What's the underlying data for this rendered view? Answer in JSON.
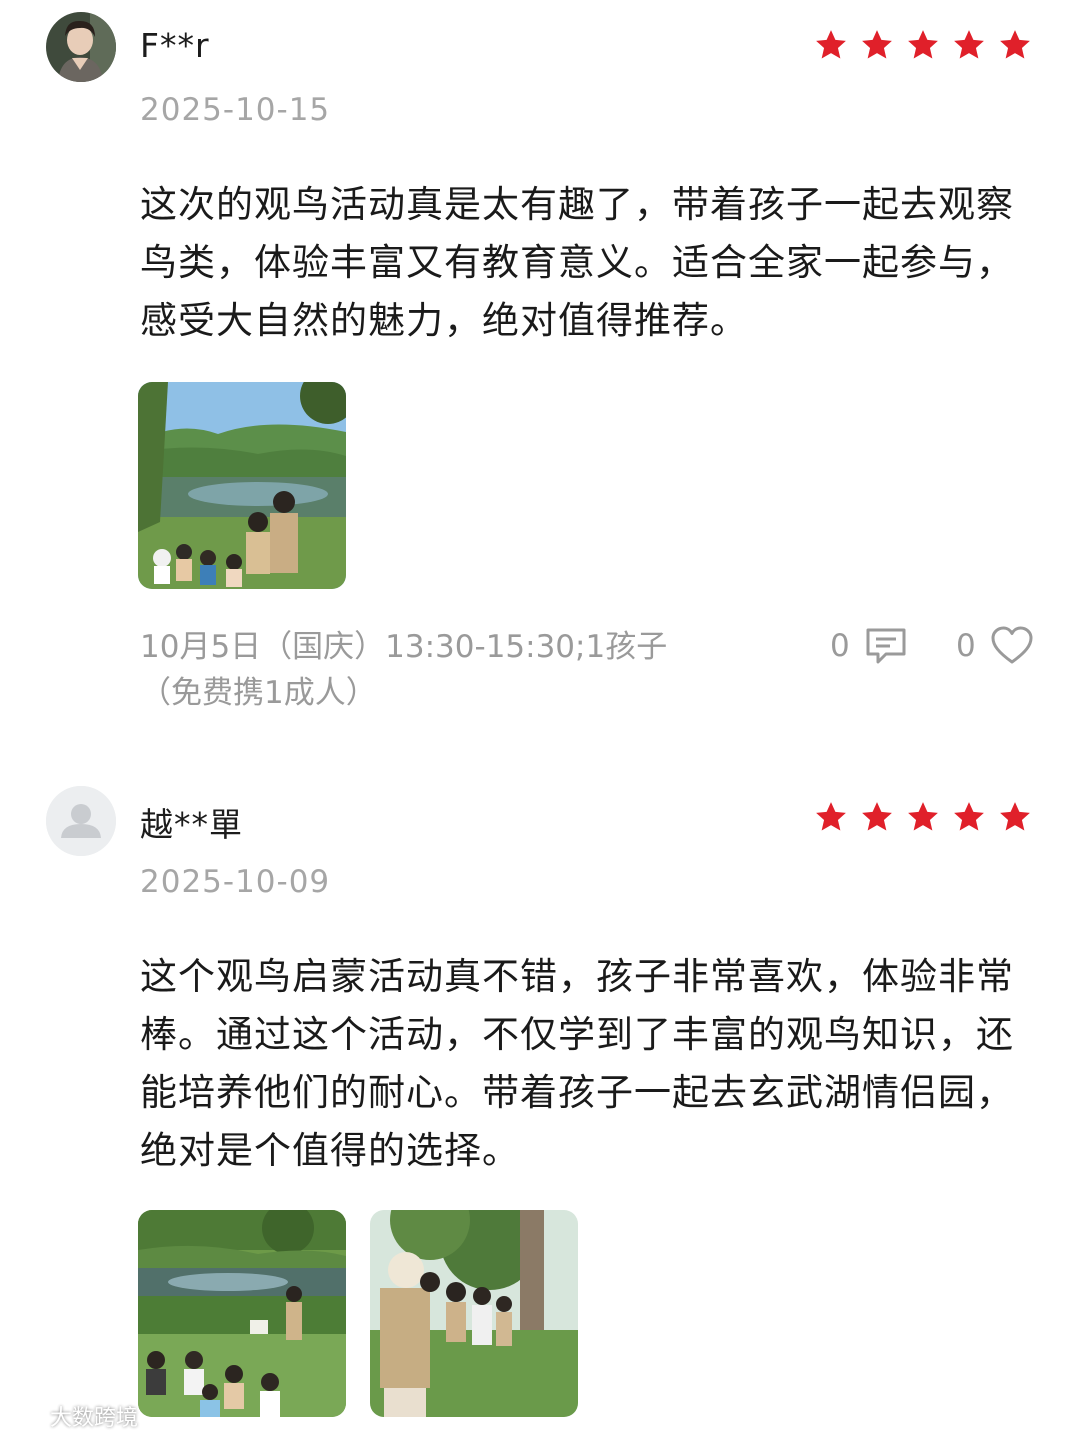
{
  "reviews": [
    {
      "username": "F**r",
      "date": "2025-10-15",
      "rating": 5,
      "content": "这次的观鸟活动真是太有趣了，带着孩子一起去观察鸟类，体验丰富又有教育意义。适合全家一起参与，感受大自然的魅力，绝对值得推荐。",
      "photos": [
        "park-pond-children-photo"
      ],
      "session": "10月5日（国庆）13:30-15:30;1孩子（免费携1成人）",
      "comment_count": "0",
      "like_count": "0"
    },
    {
      "username": "越**單",
      "date": "2025-10-09",
      "rating": 5,
      "content": "这个观鸟启蒙活动真不错，孩子非常喜欢，体验非常棒。通过这个活动，不仅学到了丰富的观鸟知识，还能培养他们的耐心。带着孩子一起去玄武湖情侣园，绝对是个值得的选择。",
      "photos": [
        "lakeside-lesson-photo",
        "children-binoculars-photo"
      ]
    }
  ],
  "watermark": "大数跨境",
  "colors": {
    "star": "#e0202a",
    "muted_text": "#a6a6a6",
    "body_text": "#1a1a1a"
  },
  "icons": [
    "comment-icon",
    "heart-icon",
    "star-icon",
    "default-avatar-icon"
  ]
}
